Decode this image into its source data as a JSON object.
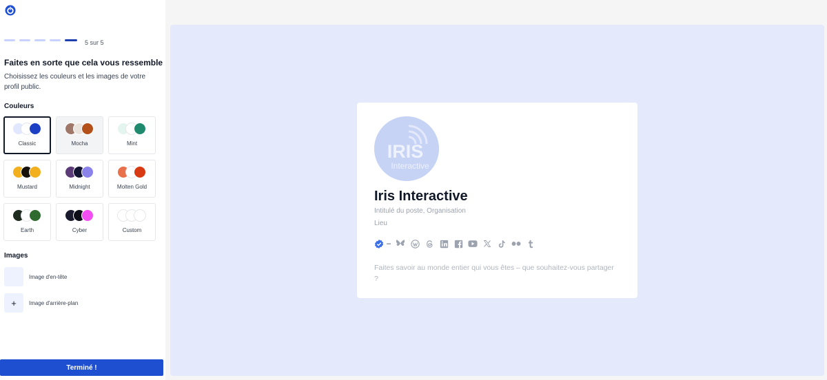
{
  "progress": {
    "label": "5 sur 5",
    "total": 5,
    "current": 5
  },
  "heading": {
    "title": "Faites en sorte que cela vous ressemble",
    "subtitle": "Choisissez les couleurs et les images de votre profil public."
  },
  "colors": {
    "section_title": "Couleurs",
    "themes": [
      {
        "name": "Classic",
        "swatches": [
          "#e0e7ff",
          "#ffffff",
          "#1d3fc4"
        ],
        "selected": true
      },
      {
        "name": "Mocha",
        "swatches": [
          "#a0786a",
          "#ebe4de",
          "#b4501a"
        ],
        "selected": false
      },
      {
        "name": "Mint",
        "swatches": [
          "#e3f5ee",
          "#ffffff",
          "#1f8a6d"
        ],
        "selected": false
      },
      {
        "name": "Mustard",
        "swatches": [
          "#f2b01e",
          "#16110b",
          "#f2b01e"
        ],
        "selected": false
      },
      {
        "name": "Midnight",
        "swatches": [
          "#5b3a78",
          "#141433",
          "#8b83ea"
        ],
        "selected": false
      },
      {
        "name": "Molten Gold",
        "swatches": [
          "#e8704a",
          "#ffffff",
          "#d83a14"
        ],
        "selected": false
      },
      {
        "name": "Earth",
        "swatches": [
          "#1f2b1f",
          "#ffffff",
          "#2f6a2f"
        ],
        "selected": false
      },
      {
        "name": "Cyber",
        "swatches": [
          "#1a1a2e",
          "#0d0d18",
          "#f24ef2"
        ],
        "selected": false
      },
      {
        "name": "Custom",
        "swatches": [
          "#ffffff",
          "#ffffff",
          "#ffffff"
        ],
        "selected": false
      }
    ]
  },
  "images": {
    "section_title": "Images",
    "header_label": "Image d'en-tête",
    "background_label": "Image d'arrière-plan",
    "add_symbol": "+"
  },
  "done_button": "Terminé !",
  "profile": {
    "name": "Iris Interactive",
    "job": "Intitulé du poste, Organisation",
    "location": "Lieu",
    "verified_dash": "–",
    "bio": "Faites savoir au monde entier qui vous êtes – que souhaitez-vous partager ?",
    "avatar_text_main": "IRIS",
    "avatar_text_sub": "Interactive"
  },
  "social_icons": [
    "bluesky-icon",
    "wordpress-icon",
    "threads-icon",
    "linkedin-icon",
    "facebook-icon",
    "youtube-icon",
    "x-icon",
    "tiktok-icon",
    "flickr-icon",
    "tumblr-icon"
  ],
  "accent": "#1e4fd1"
}
